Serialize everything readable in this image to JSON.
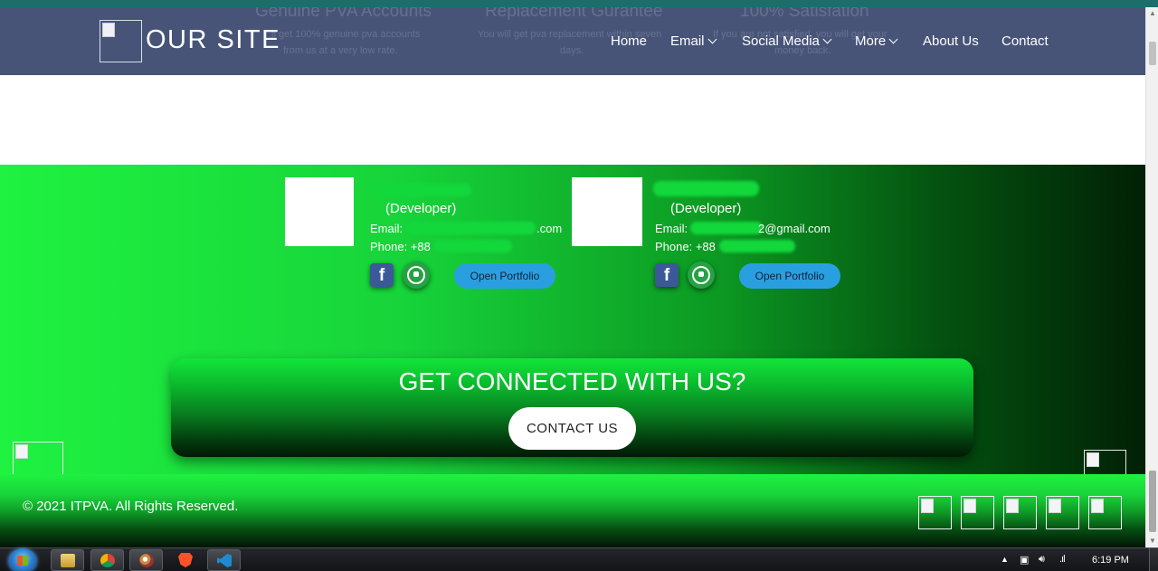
{
  "header": {
    "brand": "OUR SITE",
    "faded_titles": [
      "Genuine PVA Accounts",
      "Replacement Gurantee",
      "100% Satisfation"
    ],
    "faded_texts": [
      "ll get 100% genuine pva accounts",
      "from us at a very low rate.",
      "You will get pva replacement within seven",
      "days.",
      "If you are not satisfied, you will get your",
      "money back."
    ],
    "nav": {
      "home": "Home",
      "email": "Email",
      "social_media": "Social Media",
      "more": "More",
      "about": "About Us",
      "contact": "Contact"
    }
  },
  "developers": [
    {
      "role": "(Developer)",
      "email_label": "Email:",
      "email_suffix": ".com",
      "phone_label": "Phone: +88",
      "portfolio": "Open Portfolio"
    },
    {
      "role": "(Developer)",
      "email_label": "Email:",
      "email_suffix": "2@gmail.com",
      "phone_label": "Phone: +88",
      "portfolio": "Open Portfolio"
    }
  ],
  "cta": {
    "title": "GET CONNECTED WITH US?",
    "button": "CONTACT US"
  },
  "footer": {
    "copyright": "© 2021 ITPVA. All Rights Reserved."
  },
  "taskbar": {
    "clock": "6:19 PM",
    "apps": [
      "file-explorer-icon",
      "chrome-icon",
      "paint-icon",
      "brave-icon",
      "vscode-icon"
    ]
  },
  "colors": {
    "navbar": "#475478",
    "green": "#1ff240",
    "dark_green": "#012005",
    "portfolio_button": "#2a9fe0"
  }
}
